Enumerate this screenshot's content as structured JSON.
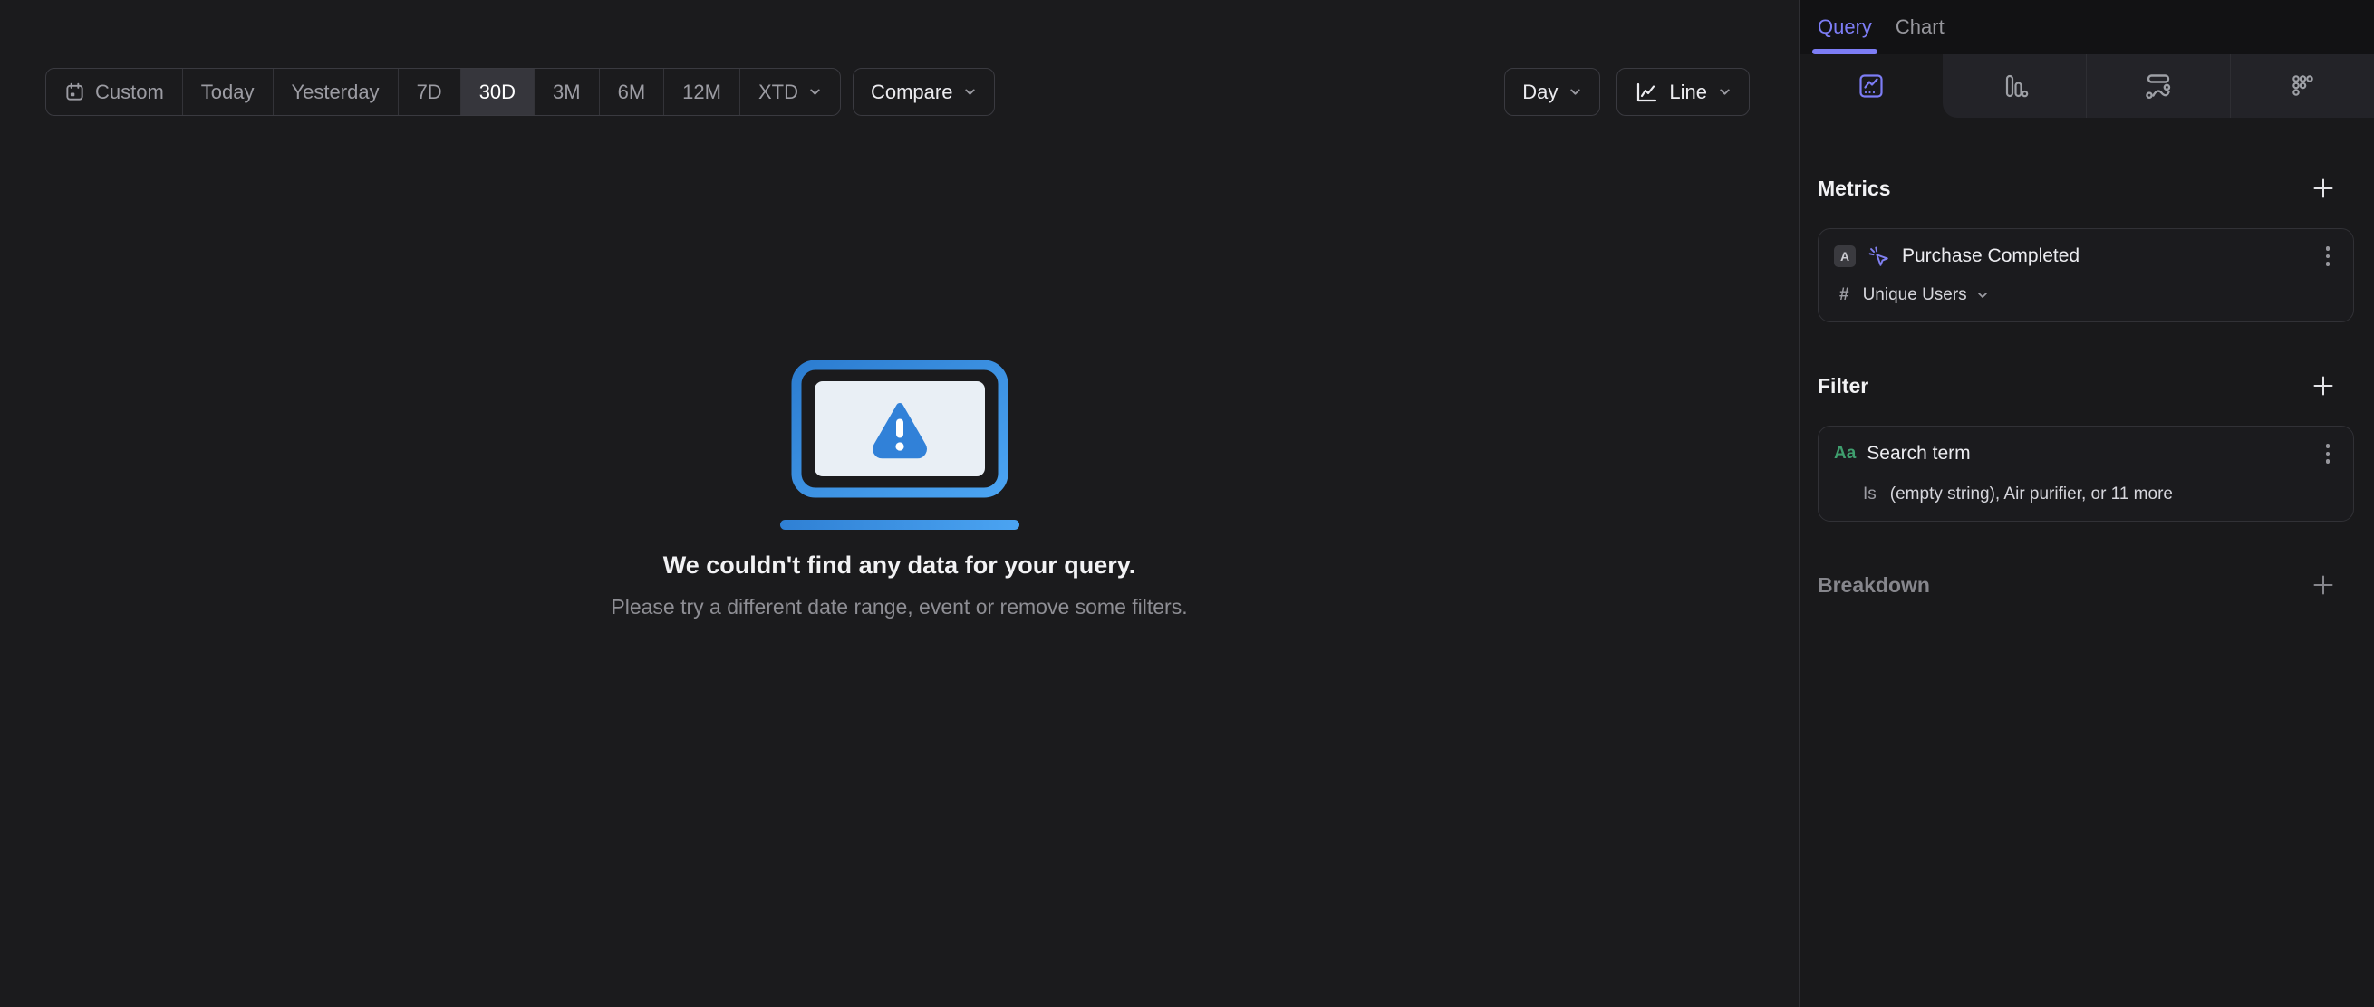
{
  "toolbar": {
    "ranges": [
      "Custom",
      "Today",
      "Yesterday",
      "7D",
      "30D",
      "3M",
      "6M",
      "12M",
      "XTD"
    ],
    "selected_range": "30D",
    "compare_label": "Compare",
    "granularity": "Day",
    "chart_type": "Line"
  },
  "empty_state": {
    "title": "We couldn't find any data for your query.",
    "subtitle": "Please try a different date range, event or remove some filters."
  },
  "sidebar": {
    "tabs": {
      "query": "Query",
      "chart": "Chart"
    },
    "add_symbol": "+",
    "metrics": {
      "header": "Metrics",
      "item": {
        "letter": "A",
        "name": "Purchase Completed",
        "aggregation_symbol": "#",
        "aggregation": "Unique Users"
      }
    },
    "filter": {
      "header": "Filter",
      "item": {
        "type_icon": "Aa",
        "name": "Search term",
        "operator": "Is",
        "values": "(empty string), Air purifier, or 11 more"
      }
    },
    "breakdown": {
      "header": "Breakdown"
    }
  },
  "icons": {
    "range_icon": "calendar",
    "chart_type_icon": "line-chart",
    "report_tabs": [
      "insights-chart",
      "funnels-bars",
      "flows-wave",
      "retention-dots"
    ],
    "metric_event_icon": "click-event",
    "empty_state_icon": "monitor-warning"
  },
  "colors": {
    "accent_purple": "#7d7df6",
    "accent_blue": "#3a8ce2",
    "green_property": "#3f9e6e",
    "background": "#1b1b1d"
  }
}
